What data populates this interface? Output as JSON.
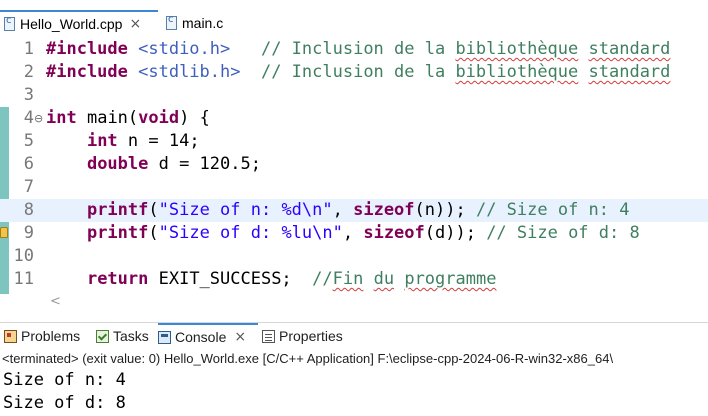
{
  "editor_tabs": [
    {
      "label": "Hello_World.cpp",
      "active": true,
      "close": "×"
    },
    {
      "label": "main.c",
      "active": false
    }
  ],
  "code_lines": [
    {
      "num": "1",
      "tokens": [
        {
          "t": "#include ",
          "c": "kw"
        },
        {
          "t": "<stdio.h>",
          "c": "inc"
        },
        {
          "t": "   "
        },
        {
          "t": "// Inclusion de la ",
          "c": "cm"
        },
        {
          "t": "bibliothèque",
          "c": "cm sq"
        },
        {
          "t": " ",
          "c": "cm"
        },
        {
          "t": "standard",
          "c": "cm sq"
        }
      ]
    },
    {
      "num": "2",
      "tokens": [
        {
          "t": "#include ",
          "c": "kw"
        },
        {
          "t": "<stdlib.h>",
          "c": "inc"
        },
        {
          "t": "  "
        },
        {
          "t": "// Inclusion de la ",
          "c": "cm"
        },
        {
          "t": "bibliothèque",
          "c": "cm sq"
        },
        {
          "t": " ",
          "c": "cm"
        },
        {
          "t": "standard",
          "c": "cm sq"
        }
      ]
    },
    {
      "num": "3",
      "tokens": []
    },
    {
      "num": "4",
      "fold": "⊖",
      "tokens": [
        {
          "t": "int",
          "c": "kw"
        },
        {
          "t": " "
        },
        {
          "t": "main",
          "c": "fn"
        },
        {
          "t": "("
        },
        {
          "t": "void",
          "c": "kw"
        },
        {
          "t": ") {"
        }
      ]
    },
    {
      "num": "5",
      "tokens": [
        {
          "t": "    "
        },
        {
          "t": "int",
          "c": "kw"
        },
        {
          "t": " n = 14;"
        }
      ]
    },
    {
      "num": "6",
      "tokens": [
        {
          "t": "    "
        },
        {
          "t": "double",
          "c": "kw"
        },
        {
          "t": " d = 120.5;"
        }
      ]
    },
    {
      "num": "7",
      "tokens": []
    },
    {
      "num": "8",
      "current": true,
      "tokens": [
        {
          "t": "    "
        },
        {
          "t": "printf",
          "c": "kw"
        },
        {
          "t": "("
        },
        {
          "t": "\"Size of n: %d\\n\"",
          "c": "str"
        },
        {
          "t": ", "
        },
        {
          "t": "sizeof",
          "c": "kw"
        },
        {
          "t": "(n)); "
        },
        {
          "t": "// Size of n: 4",
          "c": "cm"
        }
      ]
    },
    {
      "num": "9",
      "warning": true,
      "tokens": [
        {
          "t": "    "
        },
        {
          "t": "printf",
          "c": "kw"
        },
        {
          "t": "("
        },
        {
          "t": "\"Size of d: %lu\\n\"",
          "c": "str"
        },
        {
          "t": ", "
        },
        {
          "t": "sizeof",
          "c": "kw"
        },
        {
          "t": "(d)); "
        },
        {
          "t": "// Size of d: 8",
          "c": "cm"
        }
      ]
    },
    {
      "num": "10",
      "tokens": []
    },
    {
      "num": "11",
      "tokens": [
        {
          "t": "    "
        },
        {
          "t": "return",
          "c": "kw"
        },
        {
          "t": " EXIT_SUCCESS;  "
        },
        {
          "t": "//",
          "c": "cm"
        },
        {
          "t": "Fin",
          "c": "cm sq"
        },
        {
          "t": " ",
          "c": "cm"
        },
        {
          "t": "du",
          "c": "cm sq"
        },
        {
          "t": " ",
          "c": "cm"
        },
        {
          "t": "programme",
          "c": "cm sq"
        }
      ]
    }
  ],
  "scroll_left_arrow": "<",
  "view_tabs": [
    {
      "label": "Problems",
      "icon": "problems-icon"
    },
    {
      "label": "Tasks",
      "icon": "tasks-icon"
    },
    {
      "label": "Console",
      "icon": "console-icon",
      "active": true,
      "close": "×"
    },
    {
      "label": "Properties",
      "icon": "properties-icon"
    }
  ],
  "console": {
    "status": "<terminated> (exit value: 0) Hello_World.exe [C/C++ Application] F:\\eclipse-cpp-2024-06-R-win32-x86_64\\",
    "output": [
      "Size of n: 4",
      "Size of d: 8"
    ]
  },
  "colors": {
    "keyword": "#7f0055",
    "string": "#2a00ff",
    "comment": "#3f7f5f",
    "include": "#3f5fbf",
    "current_line": "#e8f2fe",
    "active_tab_border": "#3c88d6"
  }
}
